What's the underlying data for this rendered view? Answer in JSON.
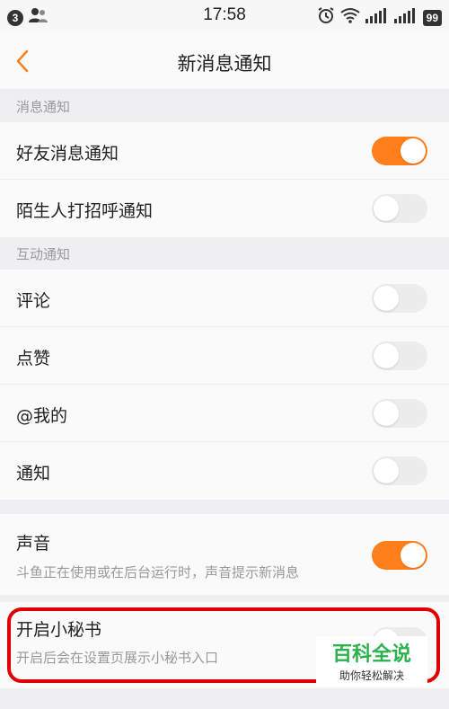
{
  "status_bar": {
    "notification_count": "3",
    "time": "17:58",
    "battery": "99"
  },
  "nav": {
    "title": "新消息通知"
  },
  "sections": {
    "message": {
      "header": "消息通知",
      "friend_label": "好友消息通知",
      "friend_on": true,
      "stranger_label": "陌生人打招呼通知",
      "stranger_on": false
    },
    "interaction": {
      "header": "互动通知",
      "comment_label": "评论",
      "like_label": "点赞",
      "mention_label": "@我的",
      "notice_label": "通知"
    },
    "sound": {
      "label": "声音",
      "desc": "斗鱼正在使用或在后台运行时，声音提示新消息",
      "on": true
    },
    "secretary": {
      "label": "开启小秘书",
      "desc": "开启后会在设置页展示小秘书入口",
      "on": false
    }
  },
  "watermark": {
    "main": "百科全说",
    "sub": "助你轻松解决"
  },
  "colors": {
    "accent": "#ff7f1c",
    "highlight": "#e00000",
    "watermark": "#2bb24c"
  }
}
